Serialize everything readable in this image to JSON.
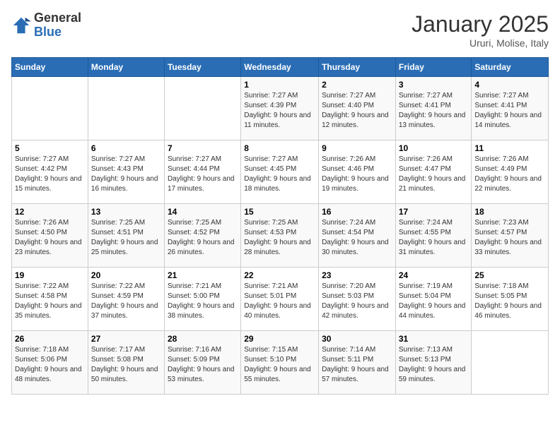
{
  "header": {
    "logo_general": "General",
    "logo_blue": "Blue",
    "month": "January 2025",
    "location": "Ururi, Molise, Italy"
  },
  "weekdays": [
    "Sunday",
    "Monday",
    "Tuesday",
    "Wednesday",
    "Thursday",
    "Friday",
    "Saturday"
  ],
  "weeks": [
    [
      {
        "day": "",
        "text": ""
      },
      {
        "day": "",
        "text": ""
      },
      {
        "day": "",
        "text": ""
      },
      {
        "day": "1",
        "text": "Sunrise: 7:27 AM\nSunset: 4:39 PM\nDaylight: 9 hours and 11 minutes."
      },
      {
        "day": "2",
        "text": "Sunrise: 7:27 AM\nSunset: 4:40 PM\nDaylight: 9 hours and 12 minutes."
      },
      {
        "day": "3",
        "text": "Sunrise: 7:27 AM\nSunset: 4:41 PM\nDaylight: 9 hours and 13 minutes."
      },
      {
        "day": "4",
        "text": "Sunrise: 7:27 AM\nSunset: 4:41 PM\nDaylight: 9 hours and 14 minutes."
      }
    ],
    [
      {
        "day": "5",
        "text": "Sunrise: 7:27 AM\nSunset: 4:42 PM\nDaylight: 9 hours and 15 minutes."
      },
      {
        "day": "6",
        "text": "Sunrise: 7:27 AM\nSunset: 4:43 PM\nDaylight: 9 hours and 16 minutes."
      },
      {
        "day": "7",
        "text": "Sunrise: 7:27 AM\nSunset: 4:44 PM\nDaylight: 9 hours and 17 minutes."
      },
      {
        "day": "8",
        "text": "Sunrise: 7:27 AM\nSunset: 4:45 PM\nDaylight: 9 hours and 18 minutes."
      },
      {
        "day": "9",
        "text": "Sunrise: 7:26 AM\nSunset: 4:46 PM\nDaylight: 9 hours and 19 minutes."
      },
      {
        "day": "10",
        "text": "Sunrise: 7:26 AM\nSunset: 4:47 PM\nDaylight: 9 hours and 21 minutes."
      },
      {
        "day": "11",
        "text": "Sunrise: 7:26 AM\nSunset: 4:49 PM\nDaylight: 9 hours and 22 minutes."
      }
    ],
    [
      {
        "day": "12",
        "text": "Sunrise: 7:26 AM\nSunset: 4:50 PM\nDaylight: 9 hours and 23 minutes."
      },
      {
        "day": "13",
        "text": "Sunrise: 7:25 AM\nSunset: 4:51 PM\nDaylight: 9 hours and 25 minutes."
      },
      {
        "day": "14",
        "text": "Sunrise: 7:25 AM\nSunset: 4:52 PM\nDaylight: 9 hours and 26 minutes."
      },
      {
        "day": "15",
        "text": "Sunrise: 7:25 AM\nSunset: 4:53 PM\nDaylight: 9 hours and 28 minutes."
      },
      {
        "day": "16",
        "text": "Sunrise: 7:24 AM\nSunset: 4:54 PM\nDaylight: 9 hours and 30 minutes."
      },
      {
        "day": "17",
        "text": "Sunrise: 7:24 AM\nSunset: 4:55 PM\nDaylight: 9 hours and 31 minutes."
      },
      {
        "day": "18",
        "text": "Sunrise: 7:23 AM\nSunset: 4:57 PM\nDaylight: 9 hours and 33 minutes."
      }
    ],
    [
      {
        "day": "19",
        "text": "Sunrise: 7:22 AM\nSunset: 4:58 PM\nDaylight: 9 hours and 35 minutes."
      },
      {
        "day": "20",
        "text": "Sunrise: 7:22 AM\nSunset: 4:59 PM\nDaylight: 9 hours and 37 minutes."
      },
      {
        "day": "21",
        "text": "Sunrise: 7:21 AM\nSunset: 5:00 PM\nDaylight: 9 hours and 38 minutes."
      },
      {
        "day": "22",
        "text": "Sunrise: 7:21 AM\nSunset: 5:01 PM\nDaylight: 9 hours and 40 minutes."
      },
      {
        "day": "23",
        "text": "Sunrise: 7:20 AM\nSunset: 5:03 PM\nDaylight: 9 hours and 42 minutes."
      },
      {
        "day": "24",
        "text": "Sunrise: 7:19 AM\nSunset: 5:04 PM\nDaylight: 9 hours and 44 minutes."
      },
      {
        "day": "25",
        "text": "Sunrise: 7:18 AM\nSunset: 5:05 PM\nDaylight: 9 hours and 46 minutes."
      }
    ],
    [
      {
        "day": "26",
        "text": "Sunrise: 7:18 AM\nSunset: 5:06 PM\nDaylight: 9 hours and 48 minutes."
      },
      {
        "day": "27",
        "text": "Sunrise: 7:17 AM\nSunset: 5:08 PM\nDaylight: 9 hours and 50 minutes."
      },
      {
        "day": "28",
        "text": "Sunrise: 7:16 AM\nSunset: 5:09 PM\nDaylight: 9 hours and 53 minutes."
      },
      {
        "day": "29",
        "text": "Sunrise: 7:15 AM\nSunset: 5:10 PM\nDaylight: 9 hours and 55 minutes."
      },
      {
        "day": "30",
        "text": "Sunrise: 7:14 AM\nSunset: 5:11 PM\nDaylight: 9 hours and 57 minutes."
      },
      {
        "day": "31",
        "text": "Sunrise: 7:13 AM\nSunset: 5:13 PM\nDaylight: 9 hours and 59 minutes."
      },
      {
        "day": "",
        "text": ""
      }
    ]
  ]
}
